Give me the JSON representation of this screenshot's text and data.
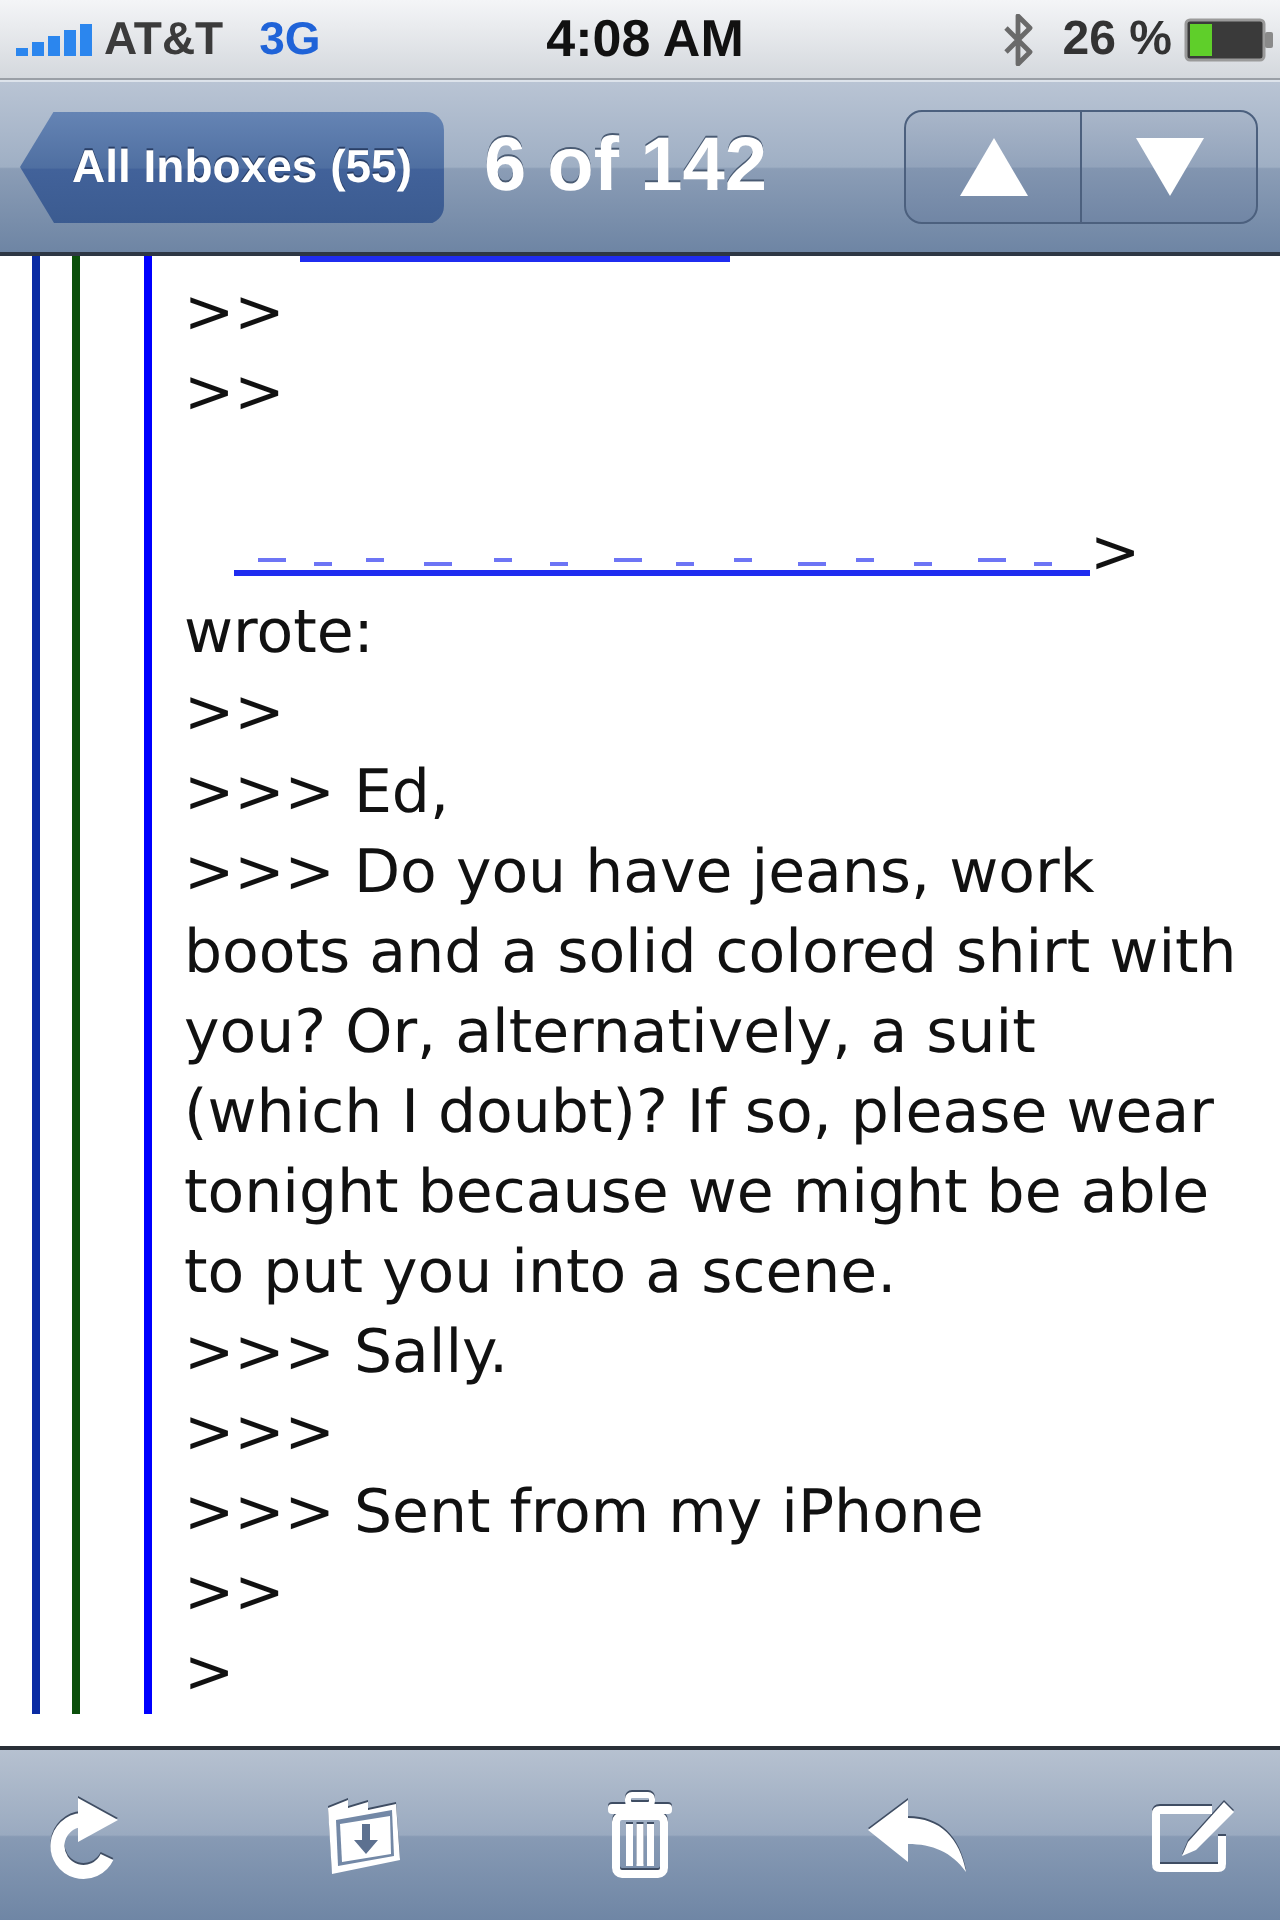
{
  "status_bar": {
    "carrier": "AT&T",
    "network": "3G",
    "time": "4:08 AM",
    "battery": "26 %"
  },
  "nav_bar": {
    "back_button": "All Inboxes (55)",
    "title": "6 of 142",
    "arrows": [
      {
        "kind": "up"
      },
      {
        "kind": "down"
      }
    ]
  },
  "message": {
    "quote_bars": [
      {
        "color": "#0a2ba3"
      },
      {
        "color": "#0b4f0b"
      },
      {
        "color": "#0000ff"
      }
    ],
    "lines": [
      {
        "kind": "cut_link"
      },
      {
        "kind": "text",
        "text": ">>"
      },
      {
        "kind": "text",
        "text": ">>"
      },
      {
        "kind": "blank"
      },
      {
        "kind": "link",
        "after": ">"
      },
      {
        "kind": "text",
        "text": "wrote:"
      },
      {
        "kind": "text",
        "text": ">>"
      },
      {
        "kind": "text",
        "text": ">>> Ed,"
      },
      {
        "kind": "text",
        "text": ">>> Do you have jeans, work boots and a solid colored shirt with you? Or, alternatively, a suit (which I doubt)? If so, please wear tonight because we might be able to put you into a scene."
      },
      {
        "kind": "text",
        "text": ">>> Sally."
      },
      {
        "kind": "text",
        "text": ">>>"
      },
      {
        "kind": "text",
        "text": ">>> Sent from my iPhone"
      },
      {
        "kind": "text",
        "text": ">>"
      },
      {
        "kind": "text",
        "text": ">"
      }
    ]
  },
  "toolbar": {
    "buttons": [
      {
        "kind": "refresh"
      },
      {
        "kind": "move"
      },
      {
        "kind": "trash"
      },
      {
        "kind": "reply"
      },
      {
        "kind": "compose"
      }
    ]
  }
}
